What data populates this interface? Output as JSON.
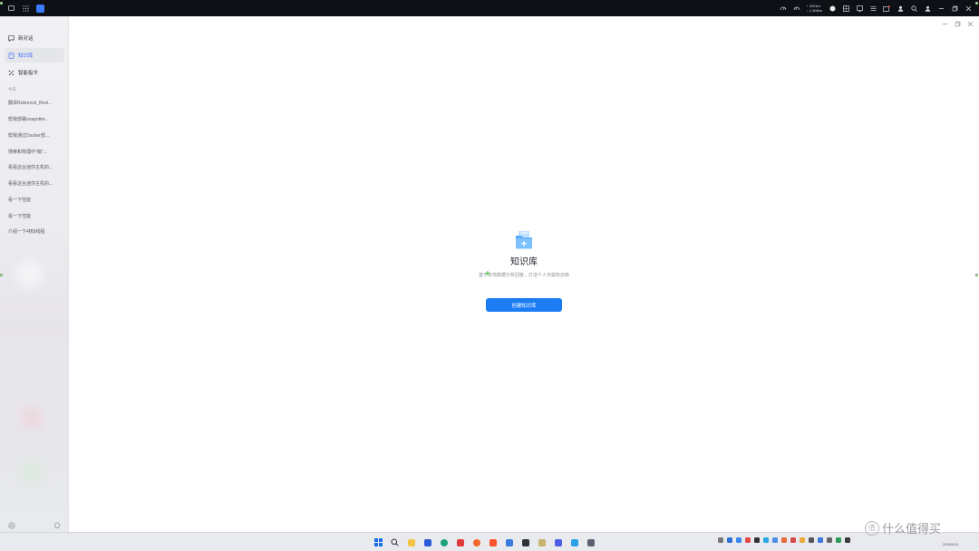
{
  "topbar": {
    "net_up": "↑ 22Kb/s",
    "net_down": "↓ 2.4Mb/s"
  },
  "sidebar": {
    "items": [
      {
        "label": "新对话",
        "icon": "chat-icon"
      },
      {
        "label": "知识库",
        "icon": "book-icon",
        "active": true
      },
      {
        "label": "智能指令",
        "icon": "magic-wand-icon"
      }
    ],
    "section_today": "今天",
    "history": [
      "翻译Roborock_Revi...",
      "帮我部署snapotter...",
      "帮我通过Docker部...",
      "搜索和梳理中\"缩\"...",
      "看看这台迷你主机的...",
      "看看这台迷你主机的...",
      "看一下性能",
      "看一下性能",
      "介绍一下4核8线程"
    ]
  },
  "main": {
    "title": "知识库",
    "description": "基于本地数据分析回答，打造个人专属知识库",
    "create_button": "创建知识库"
  },
  "watermark": {
    "circle_char": "值",
    "text": "什么值得买"
  },
  "taskbar": {
    "date": "2026/3/11"
  },
  "colors": {
    "accent": "#1b7cf5",
    "active_nav": "#3d6bff"
  }
}
